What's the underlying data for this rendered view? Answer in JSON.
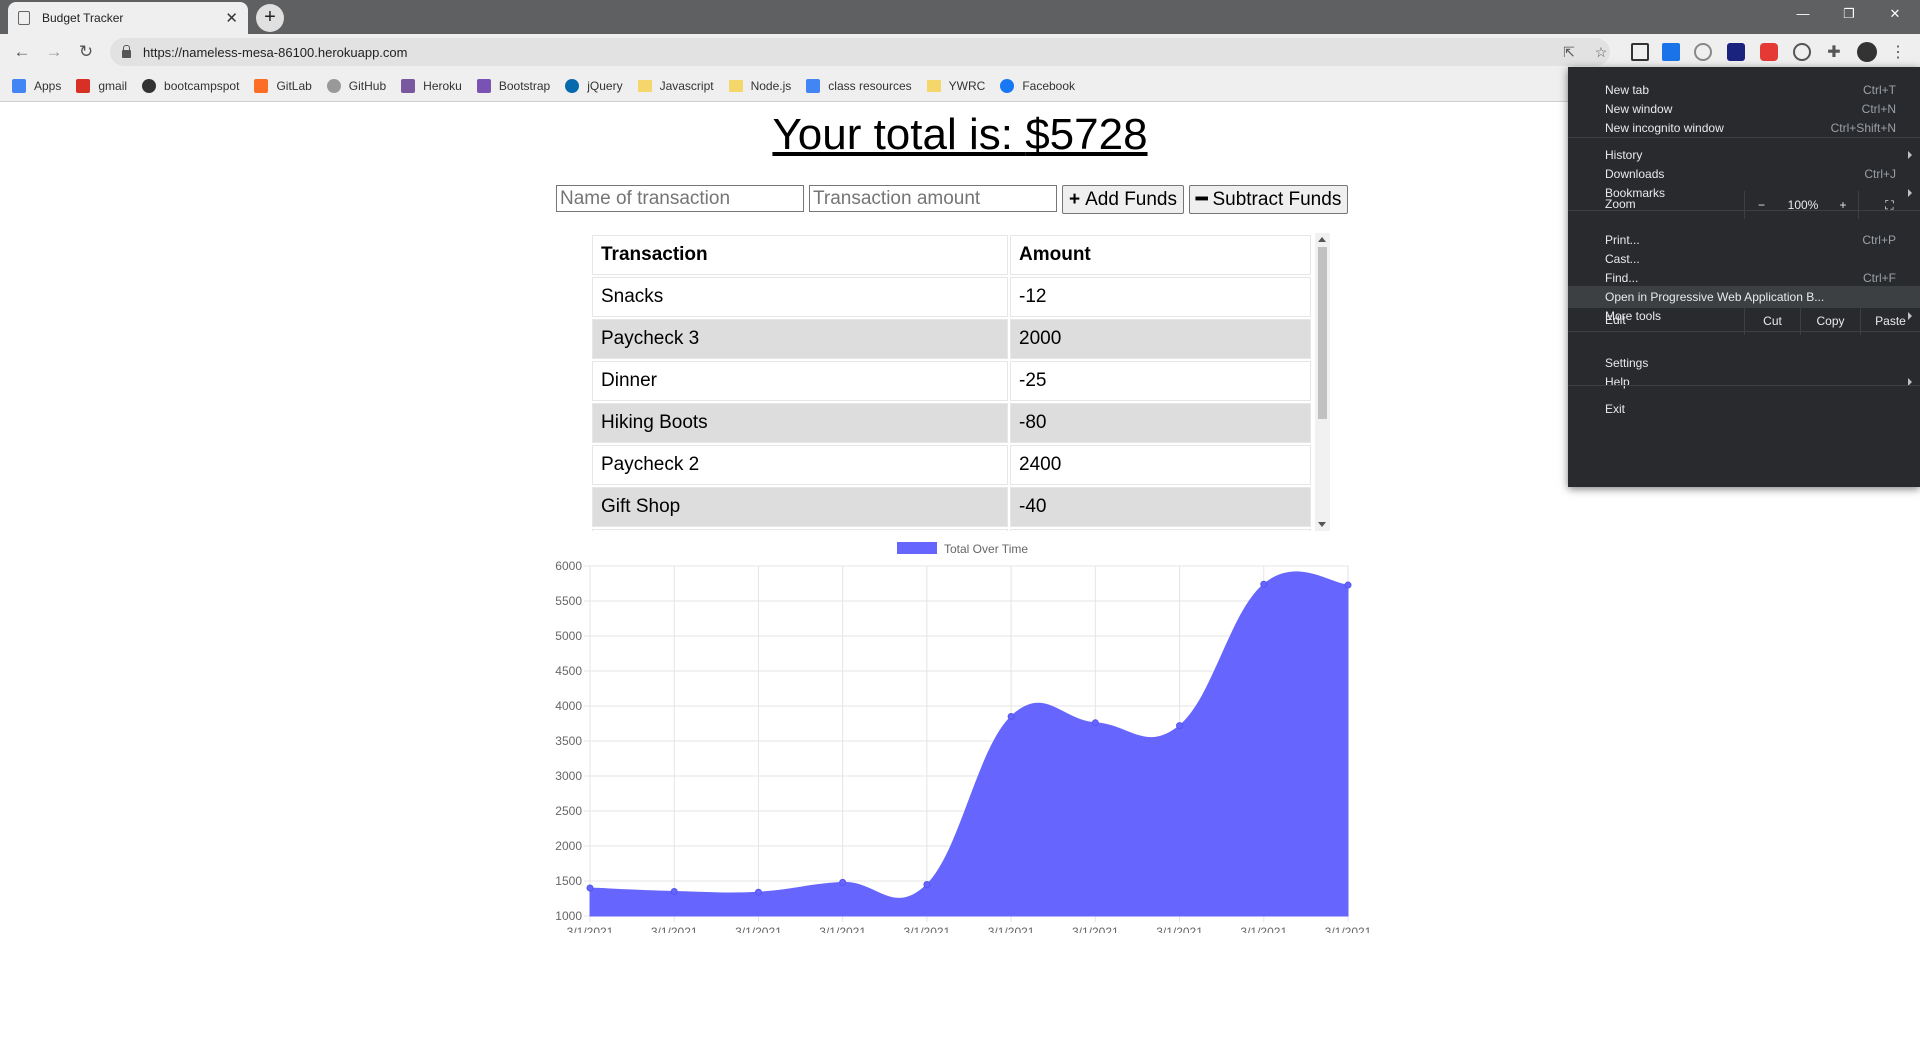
{
  "browser": {
    "tab_title": "Budget Tracker",
    "url": "https://nameless-mesa-86100.herokuapp.com",
    "bookmarks": [
      {
        "label": "Apps",
        "icon": "apps-grid-icon",
        "color": "#4285f4"
      },
      {
        "label": "gmail",
        "icon": "gmail-icon",
        "color": "#d93025"
      },
      {
        "label": "bootcampspot",
        "icon": "bootcampspot-icon",
        "color": "#333333"
      },
      {
        "label": "GitLab",
        "icon": "gitlab-icon",
        "color": "#fc6d26"
      },
      {
        "label": "GitHub",
        "icon": "github-icon",
        "color": "#999999"
      },
      {
        "label": "Heroku",
        "icon": "heroku-icon",
        "color": "#79589f"
      },
      {
        "label": "Bootstrap",
        "icon": "bootstrap-icon",
        "color": "#7952b3"
      },
      {
        "label": "jQuery",
        "icon": "jquery-icon",
        "color": "#0769ad"
      },
      {
        "label": "Javascript",
        "icon": "folder-icon",
        "color": "#f4d66a"
      },
      {
        "label": "Node.js",
        "icon": "folder-icon",
        "color": "#f4d66a"
      },
      {
        "label": "class resources",
        "icon": "docs-icon",
        "color": "#4285f4"
      },
      {
        "label": "YWRC",
        "icon": "folder-icon",
        "color": "#f4d66a"
      },
      {
        "label": "Facebook",
        "icon": "facebook-icon",
        "color": "#1877f2"
      }
    ]
  },
  "app": {
    "total_prefix": "Your total is: ",
    "total_value": "$5728",
    "name_placeholder": "Name of transaction",
    "amount_placeholder": "Transaction amount",
    "add_label": "Add Funds",
    "sub_label": "Subtract Funds",
    "table_headers": [
      "Transaction",
      "Amount"
    ],
    "transactions": [
      {
        "name": "Snacks",
        "amount": "-12"
      },
      {
        "name": "Paycheck 3",
        "amount": "2000"
      },
      {
        "name": "Dinner",
        "amount": "-25"
      },
      {
        "name": "Hiking Boots",
        "amount": "-80"
      },
      {
        "name": "Paycheck 2",
        "amount": "2400"
      },
      {
        "name": "Gift Shop",
        "amount": "-40"
      }
    ]
  },
  "chart_data": {
    "type": "area",
    "legend": "Total Over Time",
    "legend_position": "top",
    "color": "#6666ff",
    "x": [
      "3/1/2021",
      "3/1/2021",
      "3/1/2021",
      "3/1/2021",
      "3/1/2021",
      "3/1/2021",
      "3/1/2021",
      "3/1/2021",
      "3/1/2021",
      "3/1/2021"
    ],
    "values": [
      1400,
      1350,
      1340,
      1480,
      1450,
      3850,
      3760,
      3720,
      5740,
      5728
    ],
    "ylim": [
      1000,
      6000
    ],
    "yticks": [
      1000,
      1500,
      2000,
      2500,
      3000,
      3500,
      4000,
      4500,
      5000,
      5500,
      6000
    ],
    "grid": true
  },
  "menu": {
    "items": [
      {
        "label": "New tab",
        "shortcut": "Ctrl+T"
      },
      {
        "label": "New window",
        "shortcut": "Ctrl+N"
      },
      {
        "label": "New incognito window",
        "shortcut": "Ctrl+Shift+N"
      },
      {
        "label": "History",
        "shortcut": ""
      },
      {
        "label": "Downloads",
        "shortcut": "Ctrl+J"
      },
      {
        "label": "Bookmarks",
        "shortcut": ""
      },
      {
        "label": "Print...",
        "shortcut": "Ctrl+P"
      },
      {
        "label": "Cast...",
        "shortcut": ""
      },
      {
        "label": "Find...",
        "shortcut": "Ctrl+F"
      },
      {
        "label": "Open in Progressive Web Application B...",
        "shortcut": ""
      },
      {
        "label": "More tools",
        "shortcut": ""
      },
      {
        "label": "Settings",
        "shortcut": ""
      },
      {
        "label": "Help",
        "shortcut": ""
      },
      {
        "label": "Exit",
        "shortcut": ""
      }
    ],
    "zoom_label": "Zoom",
    "zoom_minus": "−",
    "zoom_value": "100%",
    "zoom_plus": "+",
    "edit_label": "Edit",
    "cut": "Cut",
    "copy": "Copy",
    "paste": "Paste"
  }
}
